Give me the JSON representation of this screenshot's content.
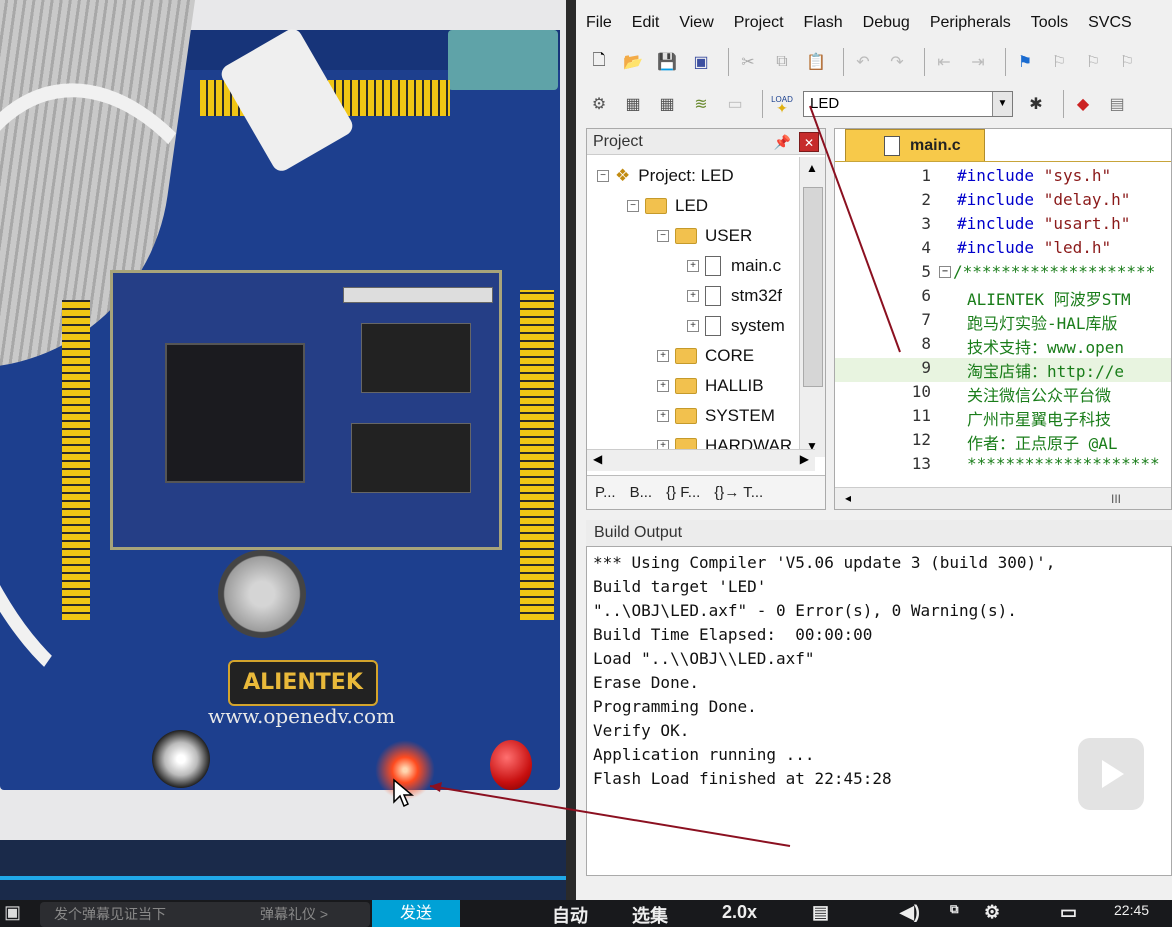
{
  "ide": {
    "menu": [
      "File",
      "Edit",
      "View",
      "Project",
      "Flash",
      "Debug",
      "Peripherals",
      "Tools",
      "SVCS"
    ],
    "target": "LED",
    "load_label": "LOAD",
    "project_panel": {
      "title": "Project",
      "tree": [
        {
          "label": "Project: LED"
        },
        {
          "label": "LED"
        },
        {
          "label": "USER"
        },
        {
          "label": "main.c"
        },
        {
          "label": "stm32f"
        },
        {
          "label": "system"
        },
        {
          "label": "CORE"
        },
        {
          "label": "HALLIB"
        },
        {
          "label": "SYSTEM"
        },
        {
          "label": "HARDWAR"
        }
      ],
      "tabs": [
        "P...",
        "B...",
        "{} F...",
        "{}→ T..."
      ]
    },
    "editor": {
      "tab": "main.c",
      "lines": [
        {
          "n": "1",
          "kw": "#include",
          "str": " \"sys.h\""
        },
        {
          "n": "2",
          "kw": "#include",
          "str": " \"delay.h\""
        },
        {
          "n": "3",
          "kw": "#include",
          "str": " \"usart.h\""
        },
        {
          "n": "4",
          "kw": "#include",
          "str": " \"led.h\""
        },
        {
          "n": "5",
          "text": "/********************"
        },
        {
          "n": "6",
          "text": "ALIENTEK 阿波罗STM"
        },
        {
          "n": "7",
          "text": "跑马灯实验-HAL库版"
        },
        {
          "n": "8",
          "text": "技术支持：www.open"
        },
        {
          "n": "9",
          "text": "淘宝店铺：http://e"
        },
        {
          "n": "10",
          "text": "关注微信公众平台微"
        },
        {
          "n": "11",
          "text": "广州市星翼电子科技"
        },
        {
          "n": "12",
          "text": "作者：正点原子 @AL"
        },
        {
          "n": "13",
          "text": "********************"
        }
      ],
      "hscroll_label": "III"
    },
    "build": {
      "title": "Build Output",
      "lines": [
        "*** Using Compiler 'V5.06 update 3 (build 300)',",
        "Build target 'LED'",
        "\"..\\OBJ\\LED.axf\" - 0 Error(s), 0 Warning(s).",
        "Build Time Elapsed:  00:00:00",
        "Load \"..\\\\OBJ\\\\LED.axf\"",
        "Erase Done.",
        "Programming Done.",
        "Verify OK.",
        "Application running ...",
        "Flash Load finished at 22:45:28"
      ]
    }
  },
  "photo": {
    "brand": "ALIENTEK",
    "url": "www.openedv.com"
  },
  "player": {
    "danmu_placeholder": "发个弹幕见证当下",
    "etiquette": "弹幕礼仪 >",
    "send": "发送",
    "auto": "自动",
    "select": "选集",
    "speed": "2.0x",
    "time": "22:45"
  },
  "colors": {
    "accent_blue": "#00a1d6",
    "tab_yellow": "#f7c94a",
    "board_blue": "#1d3f8e"
  }
}
